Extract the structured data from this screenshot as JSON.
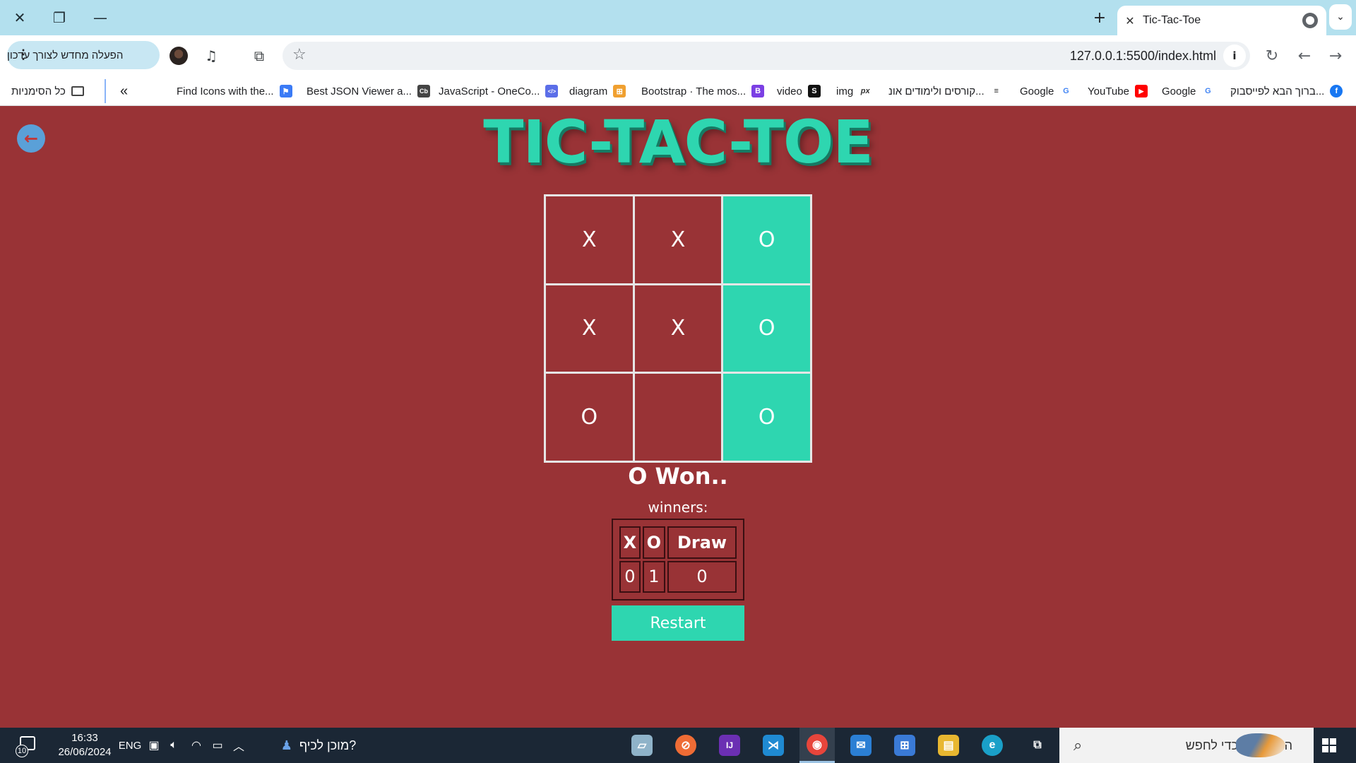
{
  "window": {
    "close_glyph": "✕",
    "restore_glyph": "❐",
    "minimize_glyph": "—"
  },
  "tab": {
    "title": "Tic-Tac-Toe",
    "close_glyph": "✕",
    "new_tab_glyph": "+",
    "menu_glyph": "⌄"
  },
  "toolbar": {
    "url": "127.0.0.1:5500/index.html",
    "update_label": "הפעלה מחדש לצורך עדכון",
    "back_glyph": "←",
    "forward_glyph": "→",
    "reload_glyph": "↻",
    "star_glyph": "☆",
    "info_glyph": "i"
  },
  "bookmarks": {
    "all_bookmarks": "כל הסימניות",
    "overflow_glyph": "«",
    "items": [
      {
        "label": "Find Icons with the...",
        "color": "#3b7bf6",
        "glyph": "⚑"
      },
      {
        "label": "Best JSON Viewer a...",
        "color": "#444444",
        "glyph": "Cb"
      },
      {
        "label": "JavaScript - OneCo...",
        "color": "#5b6ee8",
        "glyph": "</>"
      },
      {
        "label": "diagram",
        "color": "#f0a030",
        "glyph": "⊞"
      },
      {
        "label": "Bootstrap · The mos...",
        "color": "#7b3fe4",
        "glyph": "B"
      },
      {
        "label": "video",
        "color": "#111111",
        "glyph": "S"
      },
      {
        "label": "img",
        "color": "#333333",
        "glyph": "px"
      },
      {
        "label": "קורסים ולימודים אונ...",
        "color": "#222222",
        "glyph": "≡"
      },
      {
        "label": "Google",
        "color": "#4285f4",
        "glyph": "G"
      },
      {
        "label": "YouTube",
        "color": "#ff0000",
        "glyph": "▶"
      },
      {
        "label": "Google",
        "color": "#4285f4",
        "glyph": "G"
      },
      {
        "label": "ברוך הבא לפייסבוק...",
        "color": "#1877f2",
        "glyph": "f"
      }
    ]
  },
  "page": {
    "back_glyph": "←",
    "title": "TIC-TAC-TOE",
    "board": [
      {
        "mark": "X",
        "winning": false
      },
      {
        "mark": "X",
        "winning": false
      },
      {
        "mark": "O",
        "winning": true
      },
      {
        "mark": "X",
        "winning": false
      },
      {
        "mark": "X",
        "winning": false
      },
      {
        "mark": "O",
        "winning": true
      },
      {
        "mark": "O",
        "winning": false
      },
      {
        "mark": "",
        "winning": false
      },
      {
        "mark": "O",
        "winning": true
      }
    ],
    "status": "O Won..",
    "winners_label": "winners:",
    "score": {
      "headers": [
        "X",
        "O",
        "Draw"
      ],
      "values": [
        "0",
        "1",
        "0"
      ]
    },
    "restart_label": "Restart",
    "colors": {
      "background": "#993336",
      "accent": "#2ed6b0"
    }
  },
  "taskbar": {
    "time": "16:33",
    "date": "26/06/2024",
    "language": "ENG",
    "notification_count": "10",
    "weather_label": "?מוכן לכיף",
    "search_placeholder": "הקלד כאן כדי לחפש",
    "apps": [
      {
        "name": "notes-app-icon",
        "color": "#8fb3c9",
        "glyph": "▱"
      },
      {
        "name": "postman-app-icon",
        "color": "#ef6c35",
        "glyph": "⊘"
      },
      {
        "name": "intellij-app-icon",
        "color": "#6b2fb3",
        "glyph": "IJ"
      },
      {
        "name": "vscode-app-icon",
        "color": "#1f8ad2",
        "glyph": "⋊"
      },
      {
        "name": "chrome-app-icon",
        "color": "#e7453b",
        "glyph": "◉"
      },
      {
        "name": "mail-app-icon",
        "color": "#2b7fd4",
        "glyph": "✉"
      },
      {
        "name": "store-app-icon",
        "color": "#3a7ad6",
        "glyph": "⊞"
      },
      {
        "name": "explorer-app-icon",
        "color": "#e8b730",
        "glyph": "▤"
      },
      {
        "name": "edge-app-icon",
        "color": "#1aa0c8",
        "glyph": "e"
      },
      {
        "name": "task-view-icon",
        "color": "#1b2735",
        "glyph": "⧉"
      }
    ]
  }
}
